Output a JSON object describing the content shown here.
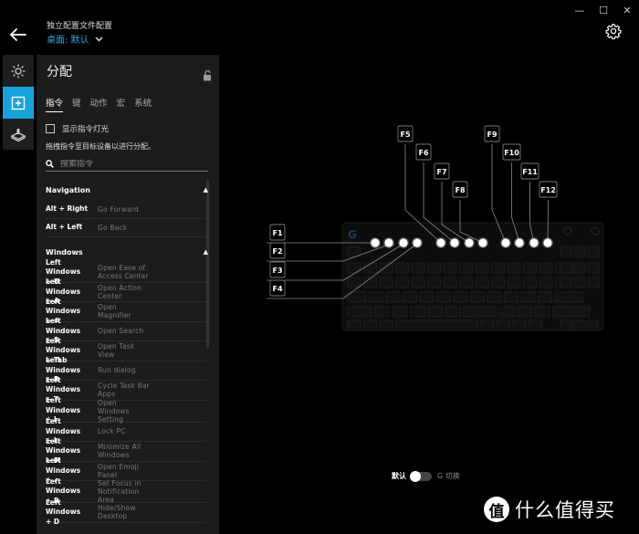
{
  "window": {
    "minimize_icon": "minimize-icon",
    "maximize_icon": "maximize-icon",
    "close_icon": "close-icon",
    "minimize": "—",
    "maximize": "☐",
    "close": "✕"
  },
  "header": {
    "back_icon": "arrow-left-icon",
    "profile_label": "独立配置文件配置",
    "profile_value": "桌面: 默认",
    "profile_chevron": "⌄",
    "settings_icon": "gear-icon"
  },
  "rail": {
    "items": [
      {
        "name": "lighting",
        "icon": "sun-icon",
        "active": false
      },
      {
        "name": "assignments",
        "icon": "plus-square-icon",
        "active": true
      },
      {
        "name": "game-mode",
        "icon": "joystick-icon",
        "active": false
      }
    ]
  },
  "panel": {
    "title": "分配",
    "lock_icon": "unlock-icon",
    "tabs": [
      {
        "label": "指令",
        "active": true
      },
      {
        "label": "键",
        "active": false
      },
      {
        "label": "动作",
        "active": false
      },
      {
        "label": "宏",
        "active": false
      },
      {
        "label": "系统",
        "active": false
      }
    ],
    "show_lighting_checkbox": {
      "label": "显示指令灯光",
      "checked": false
    },
    "hint": "拖拽指令至目标设备以进行分配。",
    "search": {
      "placeholder": "搜索指令",
      "value": ""
    },
    "groups": [
      {
        "title": "Navigation",
        "caret": "▲",
        "rows": [
          {
            "key": "Alt + Right",
            "action": "Go Forward"
          },
          {
            "key": "Alt + Left",
            "action": "Go Back"
          }
        ]
      },
      {
        "title": "Windows",
        "caret": "▲",
        "rows": [
          {
            "key1": "Left Windows",
            "key2": "+ U",
            "a1": "Open Ease of",
            "a2": "Access Center"
          },
          {
            "key1": "Left Windows",
            "key2": "+ A",
            "a1": "Open Action",
            "a2": "Center"
          },
          {
            "key1": "Left Windows",
            "key2": "+ =",
            "a1": "Open",
            "a2": "Magnifier"
          },
          {
            "key1": "Left Windows",
            "key2": "+ S",
            "a1": "Open Search",
            "a2": ""
          },
          {
            "key1": "Left Windows",
            "key2": "+ Tab",
            "a1": "Open Task",
            "a2": "View"
          },
          {
            "key1": "Left Windows",
            "key2": "+ R",
            "a1": "Run dialog",
            "a2": ""
          },
          {
            "key1": "Left Windows",
            "key2": "+ T",
            "a1": "Cycle Task Bar",
            "a2": "Apps"
          },
          {
            "key1": "Left Windows",
            "key2": "+ I",
            "a1": "Open",
            "a2": "Windows",
            "a3": "Setting"
          },
          {
            "key1": "Left Windows",
            "key2": "+ L",
            "a1": "Lock PC",
            "a2": ""
          },
          {
            "key1": "Left Windows",
            "key2": "+ M",
            "a1": "Minimize All",
            "a2": "Windows"
          },
          {
            "key1": "Left Windows",
            "key2": "+ .",
            "a1": "Open Emoji",
            "a2": "Panel"
          },
          {
            "key1": "Left Windows",
            "key2": "+ B",
            "a1": "Set Focus in",
            "a2": "Notification",
            "a3": "Area"
          },
          {
            "key1": "Left Windows",
            "key2": "+ D",
            "a1": "Hide/Show",
            "a2": "Desktop"
          }
        ]
      }
    ]
  },
  "keyboard": {
    "brand_logo": "G",
    "fkey_labels": [
      "F1",
      "F2",
      "F3",
      "F4",
      "F5",
      "F6",
      "F7",
      "F8",
      "F9",
      "F10",
      "F11",
      "F12"
    ]
  },
  "mode_toggle": {
    "left_label": "默认",
    "right_label": "G 切换",
    "state": "default"
  },
  "watermark": {
    "badge": "值",
    "text": "什么值得买"
  },
  "colors": {
    "accent": "#17a2dc",
    "profile_link": "#2fa8e0",
    "panel_bg": "#1c1c1c",
    "rail_bg": "#1e1e1e",
    "background": "#000000"
  }
}
